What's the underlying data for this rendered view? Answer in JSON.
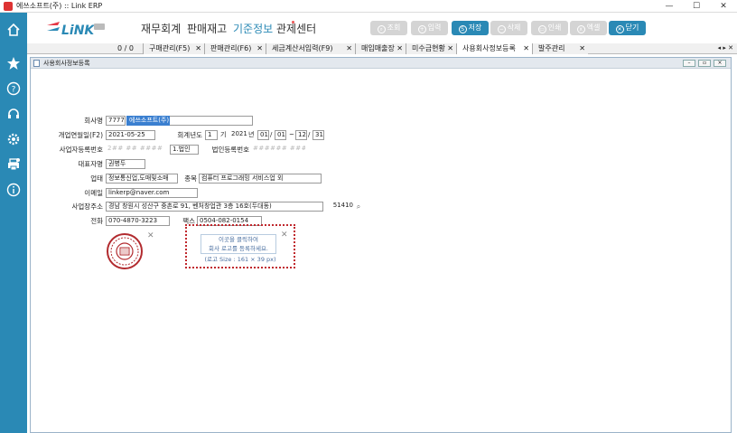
{
  "window": {
    "title": "에쓰소프트(주) :: Link ERP",
    "minimize": "—",
    "maximize": "☐",
    "close": "✕"
  },
  "sidebar": {
    "icons": [
      "home-icon",
      "star-icon",
      "help-icon",
      "support-icon",
      "settings-icon",
      "printer-icon",
      "info-icon"
    ]
  },
  "header": {
    "menus": [
      "재무회계",
      "판매재고",
      "기준정보",
      "관제센터"
    ],
    "active_menu": "기준정보",
    "buttons": [
      {
        "label": "조회",
        "icon": "search",
        "enabled": false
      },
      {
        "label": "입력",
        "icon": "plus",
        "enabled": false
      },
      {
        "label": "저장",
        "icon": "S",
        "enabled": true
      },
      {
        "label": "삭제",
        "icon": "minus",
        "enabled": false
      },
      {
        "label": "인쇄",
        "icon": "print",
        "enabled": false
      },
      {
        "label": "엑셀",
        "icon": "excel",
        "enabled": false
      },
      {
        "label": "닫기",
        "icon": "X",
        "enabled": true
      }
    ]
  },
  "tabs": {
    "counter": "0 / 0",
    "items": [
      "구매관리(F5)",
      "판매관리(F6)",
      "세금계산서입력(F9)",
      "매입매출장",
      "미수금현황",
      "사용회사정보등록",
      "발주관리"
    ],
    "active": "사용회사정보등록",
    "nav": "◂ ▸ ✕"
  },
  "form": {
    "window_title": "사용회사정보등록",
    "company_label": "회사명",
    "company_code": "7777",
    "company_name": "에쓰소프트(주)",
    "open_date_label": "개업연월일(F2)",
    "open_date": "2021-05-25",
    "fiscal_label": "회계년도",
    "fiscal_period": "1",
    "fiscal_period_suffix": "기",
    "fiscal_year": "2021",
    "year_suffix": "년",
    "fiscal_start_month": "01",
    "fiscal_start_day": "01",
    "fiscal_end_month": "12",
    "fiscal_end_day": "31",
    "date_separator": "/",
    "range_separator": "~",
    "biz_no_label": "사업자등록번호",
    "biz_no": "2## ## ####",
    "biz_type": "1.법인",
    "corp_no_label": "법인등록번호",
    "corp_no": "###### #######",
    "ceo_label": "대표자명",
    "ceo": "권병두",
    "business_label": "업태",
    "business": "정보통신업,도매및소매",
    "item_label": "종목",
    "item": "컴퓨터 프로그래밍 서비스업 외",
    "email_label": "이메일",
    "email": "linkerp@naver.com",
    "address_label": "사업장주소",
    "address": "경남 창원시 성산구 중촌로 91, 벤처창업관 3층 16호(두대동)",
    "zip": "51410",
    "phone_label": "전화",
    "phone": "070-4870-3223",
    "fax_label": "팩스",
    "fax": "0504-082-0154",
    "logo_prompt_1": "이곳을 클릭하여",
    "logo_prompt_2": "회사 로고를 등록하세요.",
    "logo_size": "(로고 Size : 161 × 39 px)",
    "remove_mark": "✕"
  },
  "colors": {
    "sidebar": "#2a89b5",
    "accent": "#2a89b5",
    "disabled_button": "#d4d4d4",
    "logo_border": "#c0282d",
    "stamp": "#b22b2f"
  }
}
